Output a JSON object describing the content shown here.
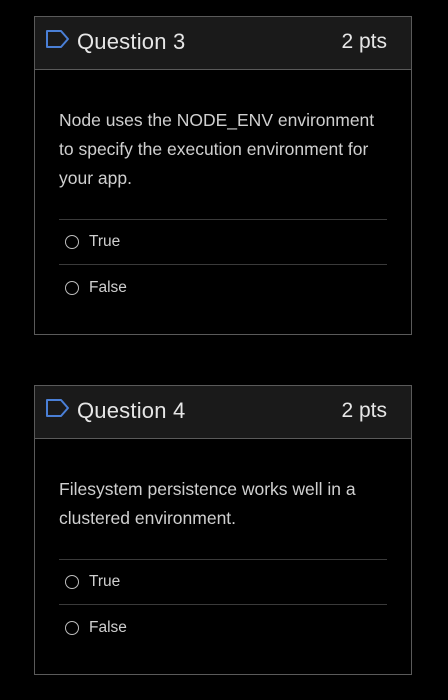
{
  "questions": [
    {
      "title": "Question 3",
      "points": "2 pts",
      "text": "Node uses the NODE_ENV environment to specify the execution environment for your app.",
      "options": [
        "True",
        "False"
      ]
    },
    {
      "title": "Question 4",
      "points": "2 pts",
      "text": "Filesystem persistence works well in a clustered environment.",
      "options": [
        "True",
        "False"
      ]
    }
  ],
  "icons": {
    "flag": "flag-icon",
    "radio": "radio-unchecked-icon"
  },
  "colors": {
    "background": "#000000",
    "header": "#1a1a1a",
    "border": "#5a5a5a",
    "flag_stroke": "#4a7fd6"
  }
}
